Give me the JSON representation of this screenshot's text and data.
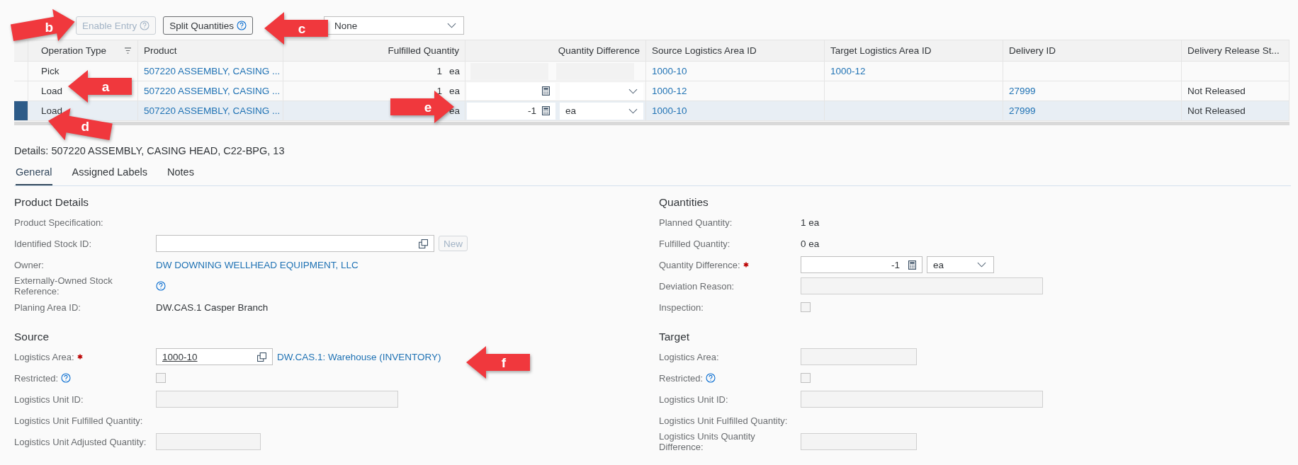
{
  "toolbar": {
    "buttons": [
      {
        "label": "Enable Entry",
        "disabled": true,
        "help": true
      },
      {
        "label": "Split Quantities",
        "disabled": false,
        "help": true
      }
    ],
    "dropdown": {
      "value": "None"
    }
  },
  "table": {
    "columns": [
      {
        "label": "Operation Type",
        "filtered": true
      },
      {
        "label": "Product",
        "filtered": false
      },
      {
        "label": "Fulfilled Quantity",
        "filtered": false
      },
      {
        "label": "Quantity Difference",
        "filtered": false
      },
      {
        "label": "Source Logistics Area ID",
        "filtered": false
      },
      {
        "label": "Target Logistics Area ID",
        "filtered": false
      },
      {
        "label": "Delivery ID",
        "filtered": false
      },
      {
        "label": "Delivery Release St...",
        "filtered": false
      }
    ],
    "rows": [
      {
        "selected": false,
        "editable": false,
        "operation_type": "Pick",
        "product": "507220 ASSEMBLY, CASING ...",
        "fulfilled_quantity": "1",
        "fulfilled_unit": "ea",
        "source": "1000-10",
        "target": "1000-12"
      },
      {
        "selected": false,
        "editable": true,
        "operation_type": "Load",
        "product": "507220 ASSEMBLY, CASING ...",
        "fulfilled_quantity": "1",
        "fulfilled_unit": "ea",
        "source": "1000-12",
        "delivery_id": "27999",
        "release_status": "Not Released"
      },
      {
        "selected": true,
        "editable": true,
        "operation_type": "Load",
        "product": "507220 ASSEMBLY, CASING ...",
        "fulfilled_unit": "ea",
        "quantity_difference": "-1",
        "difference_unit": "ea",
        "source": "1000-10",
        "delivery_id": "27999",
        "release_status": "Not Released"
      }
    ]
  },
  "details": {
    "title": "Details: 507220 ASSEMBLY, CASING HEAD, C22-BPG, 13",
    "tabs": [
      {
        "label": "General",
        "selected": true
      },
      {
        "label": "Assigned Labels",
        "selected": false
      },
      {
        "label": "Notes",
        "selected": false
      }
    ],
    "sections": [
      {
        "heading": "Product Details",
        "fields": [
          {
            "label": "Product Specification:",
            "kind": "none"
          },
          {
            "label": "Identified Stock ID:",
            "kind": "value_help",
            "button": "New",
            "button_disabled": true
          },
          {
            "label": "Owner:",
            "kind": "link",
            "value": "DW DOWNING WELLHEAD EQUIPMENT, LLC"
          },
          {
            "label": "Externally-Owned Stock Reference:",
            "kind": "help_only"
          },
          {
            "label": "Planing Area ID:",
            "kind": "text",
            "value": "DW.CAS.1 Casper Branch"
          }
        ]
      },
      {
        "heading": "Quantities",
        "fields": [
          {
            "label": "Planned Quantity:",
            "kind": "text",
            "value": "1 ea"
          },
          {
            "label": "Fulfilled Quantity:",
            "kind": "text",
            "value": "0 ea"
          },
          {
            "label": "Quantity Difference:",
            "required": true,
            "kind": "quantity",
            "value": "-1",
            "unit": "ea"
          },
          {
            "label": "Deviation Reason:",
            "kind": "wide_field"
          },
          {
            "label": "Inspection:",
            "kind": "checkbox",
            "checked": false
          }
        ]
      },
      {
        "heading": "Source",
        "fields": [
          {
            "label": "Logistics Area:",
            "required": true,
            "kind": "area",
            "value": "1000-10",
            "link": "DW.CAS.1: Warehouse (INVENTORY)"
          },
          {
            "label": "Restricted:",
            "help": true,
            "kind": "checkbox",
            "checked": false
          },
          {
            "label": "Logistics Unit ID:",
            "kind": "wide_field"
          },
          {
            "label": "Logistics Unit Fulfilled Quantity:",
            "kind": "none"
          },
          {
            "label": "Logistics Unit Adjusted Quantity:",
            "kind": "short_field"
          }
        ]
      },
      {
        "heading": "Target",
        "fields": [
          {
            "label": "Logistics Area:",
            "kind": "short_field"
          },
          {
            "label": "Restricted:",
            "help": true,
            "kind": "checkbox",
            "checked": false
          },
          {
            "label": "Logistics Unit ID:",
            "kind": "wide_field"
          },
          {
            "label": "Logistics Unit Fulfilled Quantity:",
            "kind": "none"
          },
          {
            "label": "Logistics Units Quantity Difference:",
            "kind": "short_field"
          }
        ]
      }
    ]
  },
  "callouts": [
    {
      "letter": "b"
    },
    {
      "letter": "c"
    },
    {
      "letter": "a"
    },
    {
      "letter": "e"
    },
    {
      "letter": "d"
    },
    {
      "letter": "f"
    }
  ]
}
